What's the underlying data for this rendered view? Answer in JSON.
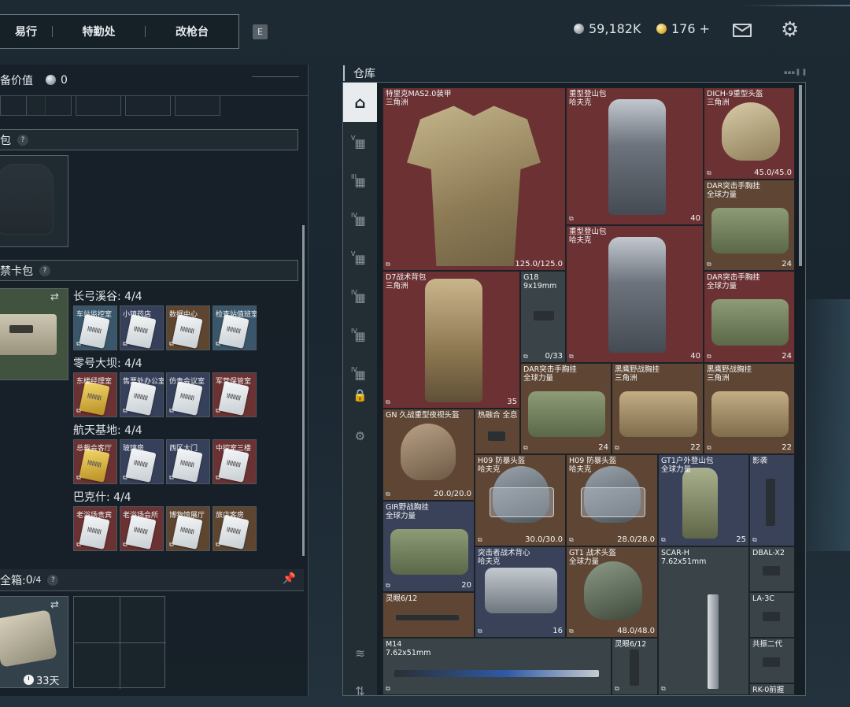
{
  "header": {
    "tabs": [
      "易行",
      "特勤处",
      "改枪台"
    ],
    "key_hint": "E",
    "silver": "59,182K",
    "gold": "176 +",
    "mail_icon": "mail-icon",
    "settings_icon": "gear-icon"
  },
  "left": {
    "value_label": "备价值",
    "value": "0",
    "bag_label": "包",
    "card_bag_label": "禁卡包",
    "groups": [
      {
        "title": "长弓溪谷: 4/4",
        "cards": [
          {
            "name": "车站监控室",
            "bg": "blue",
            "gold": false
          },
          {
            "name": "小镇药店",
            "bg": "navy",
            "gold": false
          },
          {
            "name": "数据中心",
            "bg": "brown",
            "gold": false
          },
          {
            "name": "检查站值班室",
            "bg": "blue",
            "gold": false
          }
        ]
      },
      {
        "title": "零号大坝: 4/4",
        "cards": [
          {
            "name": "东楼经理室",
            "bg": "red",
            "gold": true
          },
          {
            "name": "售票处办公室",
            "bg": "navy",
            "gold": false
          },
          {
            "name": "仿贵会议室",
            "bg": "navy",
            "gold": false
          },
          {
            "name": "军营保管室",
            "bg": "red",
            "gold": false
          }
        ]
      },
      {
        "title": "航天基地: 4/4",
        "cards": [
          {
            "name": "总裁会客厅",
            "bg": "red",
            "gold": true
          },
          {
            "name": "玻璃房",
            "bg": "navy",
            "gold": false
          },
          {
            "name": "西区大门",
            "bg": "navy",
            "gold": false
          },
          {
            "name": "中控室三楼",
            "bg": "red",
            "gold": false
          }
        ]
      },
      {
        "title": "巴克什: 4/4",
        "cards": [
          {
            "name": "老浴场贵宾",
            "bg": "red",
            "gold": false
          },
          {
            "name": "老浴场会所",
            "bg": "red",
            "gold": false
          },
          {
            "name": "博物馆展厅",
            "bg": "brown",
            "gold": false
          },
          {
            "name": "旅店客房",
            "bg": "brown",
            "gold": false
          }
        ]
      }
    ],
    "safe_label": "全箱: ",
    "safe_count": "0",
    "safe_cap": "/4",
    "safe_days": "33天"
  },
  "warehouse": {
    "title": "仓库",
    "sidebar_roman": [
      "V",
      "III",
      "IV",
      "V",
      "IV",
      "IV",
      "IV"
    ],
    "items": [
      {
        "name": "特里克MAS2.0装甲",
        "sub": "三角洲",
        "dur": "125.0/125.0"
      },
      {
        "name": "重型登山包",
        "sub": "哈夫克",
        "dur": "40"
      },
      {
        "name": "DICH-9重型头盔",
        "sub": "三角洲",
        "dur": "45.0/45.0"
      },
      {
        "name": "DAR突击手胸挂",
        "sub": "全球力量",
        "dur": "24"
      },
      {
        "name": "重型登山包",
        "sub": "哈夫克",
        "dur": "40"
      },
      {
        "name": "DAR突击手胸挂",
        "sub": "全球力量",
        "dur": "24"
      },
      {
        "name": "D7战术背包",
        "sub": "三角洲",
        "dur": "35"
      },
      {
        "name": "G18",
        "sub": "9x19mm",
        "dur": "0/33"
      },
      {
        "name": "DAR突击手胸挂",
        "sub": "全球力量",
        "dur": "24"
      },
      {
        "name": "黑鹰野战胸挂",
        "sub": "三角洲",
        "dur": "22"
      },
      {
        "name": "黑鹰野战胸挂",
        "sub": "三角洲",
        "dur": "22"
      },
      {
        "name": "GN 久战重型夜视头盔",
        "sub": "",
        "dur": "20.0/20.0"
      },
      {
        "name": "热融合 全息",
        "sub": "",
        "dur": ""
      },
      {
        "name": "H09 防暴头盔",
        "sub": "哈夫克",
        "dur": "30.0/30.0"
      },
      {
        "name": "H09 防暴头盔",
        "sub": "哈夫克",
        "dur": "28.0/28.0"
      },
      {
        "name": "GT1户外登山包",
        "sub": "全球力量",
        "dur": "25"
      },
      {
        "name": "影袭",
        "sub": "",
        "dur": ""
      },
      {
        "name": "GIR野战胸挂",
        "sub": "全球力量",
        "dur": "20"
      },
      {
        "name": "突击者战术背心",
        "sub": "哈夫克",
        "dur": "16"
      },
      {
        "name": "GT1 战术头盔",
        "sub": "全球力量",
        "dur": "48.0/48.0"
      },
      {
        "name": "SCAR-H",
        "sub": "7.62x51mm",
        "dur": ""
      },
      {
        "name": "DBAL-X2",
        "sub": "",
        "dur": ""
      },
      {
        "name": "灵眼6/12",
        "sub": "",
        "dur": ""
      },
      {
        "name": "LA-3C",
        "sub": "",
        "dur": ""
      },
      {
        "name": "M14",
        "sub": "7.62x51mm",
        "dur": ""
      },
      {
        "name": "灵眼6/12",
        "sub": "",
        "dur": ""
      },
      {
        "name": "共振二代",
        "sub": "",
        "dur": ""
      },
      {
        "name": "RK-0前握",
        "sub": "",
        "dur": ""
      }
    ]
  }
}
